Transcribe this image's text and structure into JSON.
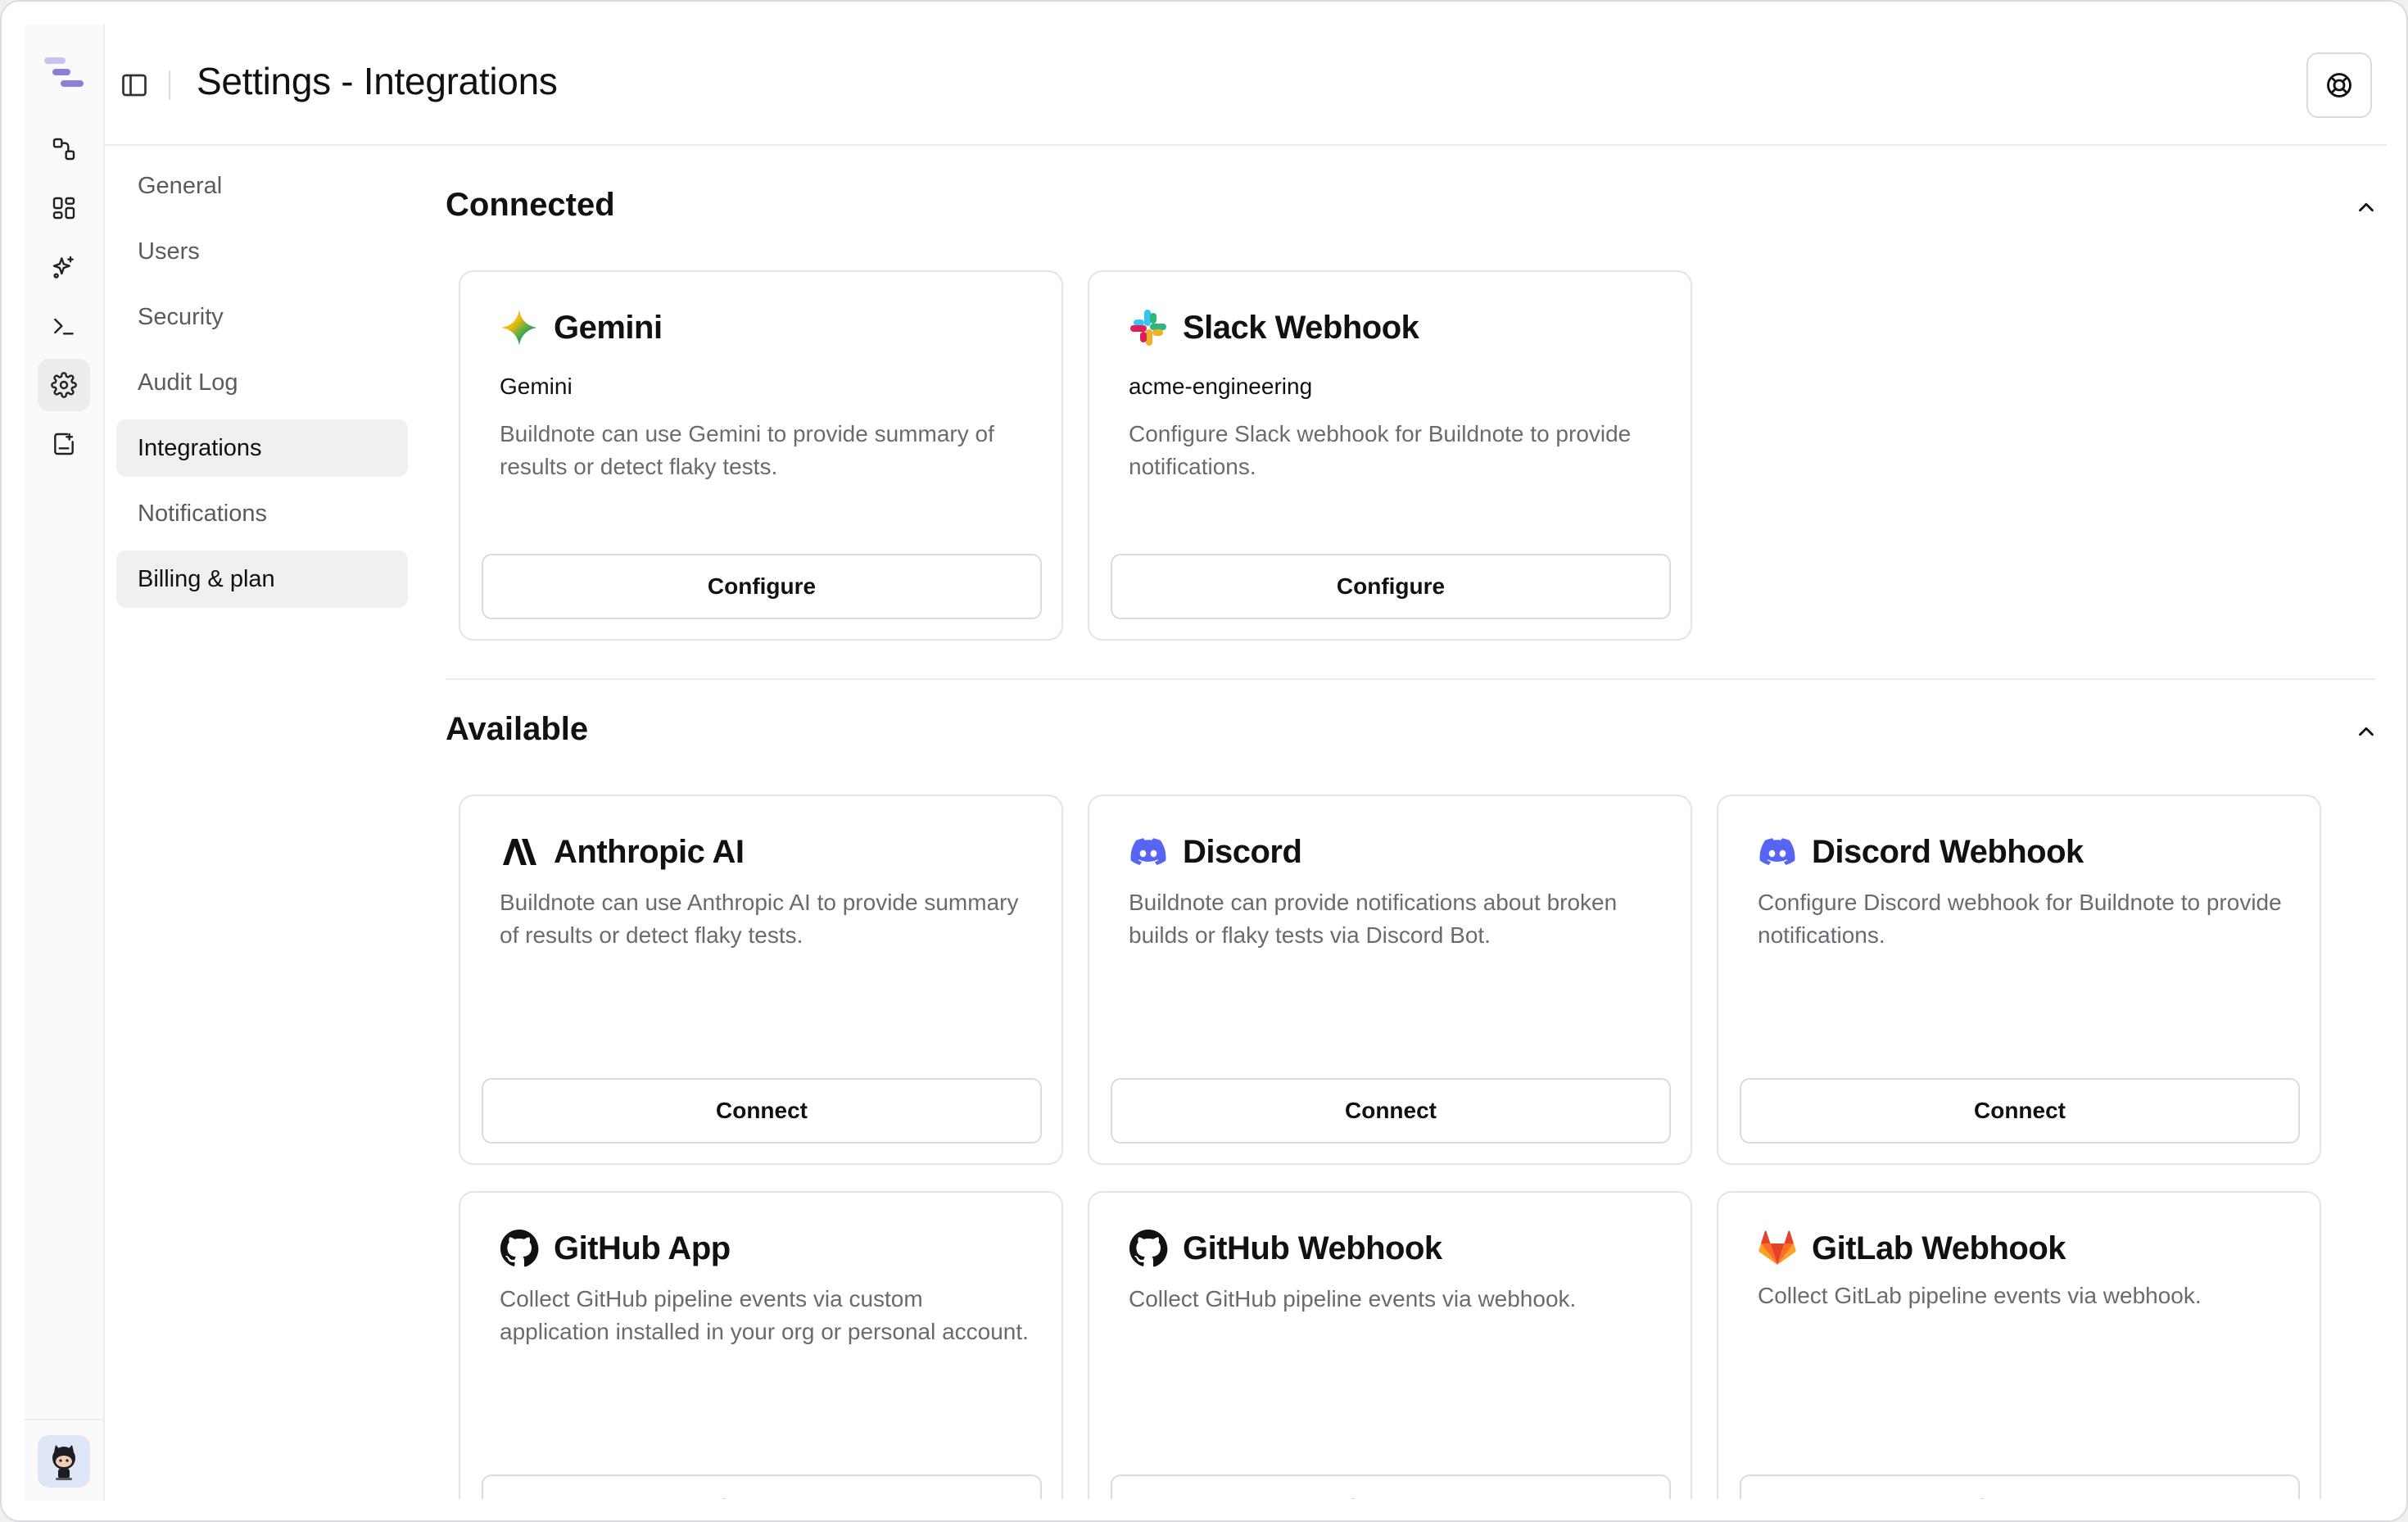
{
  "header": {
    "title": "Settings - Integrations"
  },
  "sidebar": {
    "nav": [
      {
        "label": "General"
      },
      {
        "label": "Users"
      },
      {
        "label": "Security"
      },
      {
        "label": "Audit Log"
      },
      {
        "label": "Integrations"
      },
      {
        "label": "Notifications"
      },
      {
        "label": "Billing & plan"
      }
    ],
    "active": "Integrations"
  },
  "rail": {
    "icons": [
      "workflow-icon",
      "dashboard-icon",
      "sparkle-icon",
      "terminal-icon",
      "gear-icon",
      "clipboard-icon"
    ]
  },
  "sections": {
    "connected": {
      "title": "Connected",
      "cards": [
        {
          "name": "Gemini",
          "account": "Gemini",
          "description": "Buildnote can use Gemini to provide summary of results or detect flaky tests.",
          "button": "Configure",
          "icon": "gemini-icon"
        },
        {
          "name": "Slack Webhook",
          "account": "acme-engineering",
          "description": "Configure Slack webhook for Buildnote to provide notifications.",
          "button": "Configure",
          "icon": "slack-icon"
        }
      ]
    },
    "available": {
      "title": "Available",
      "cards": [
        {
          "name": "Anthropic AI",
          "description": "Buildnote can use Anthropic AI to provide summary of results or detect flaky tests.",
          "button": "Connect",
          "icon": "anthropic-icon"
        },
        {
          "name": "Discord",
          "description": "Buildnote can provide notifications about broken builds or flaky tests via Discord Bot.",
          "button": "Connect",
          "icon": "discord-icon"
        },
        {
          "name": "Discord Webhook",
          "description": "Configure Discord webhook for Buildnote to provide notifications.",
          "button": "Connect",
          "icon": "discord-icon"
        },
        {
          "name": "GitHub App",
          "description": "Collect GitHub pipeline events via custom application installed in your org or personal account.",
          "button": "Connect",
          "icon": "github-icon"
        },
        {
          "name": "GitHub Webhook",
          "description": "Collect GitHub pipeline events via webhook.",
          "button": "Connect",
          "icon": "github-icon"
        },
        {
          "name": "GitLab Webhook",
          "description": "Collect GitLab pipeline events via webhook.",
          "button": "Connect",
          "icon": "gitlab-icon"
        }
      ]
    }
  },
  "colors": {
    "discord": "#5865F2",
    "gitlab": "#E24329",
    "brand": "#8b7fd6"
  }
}
